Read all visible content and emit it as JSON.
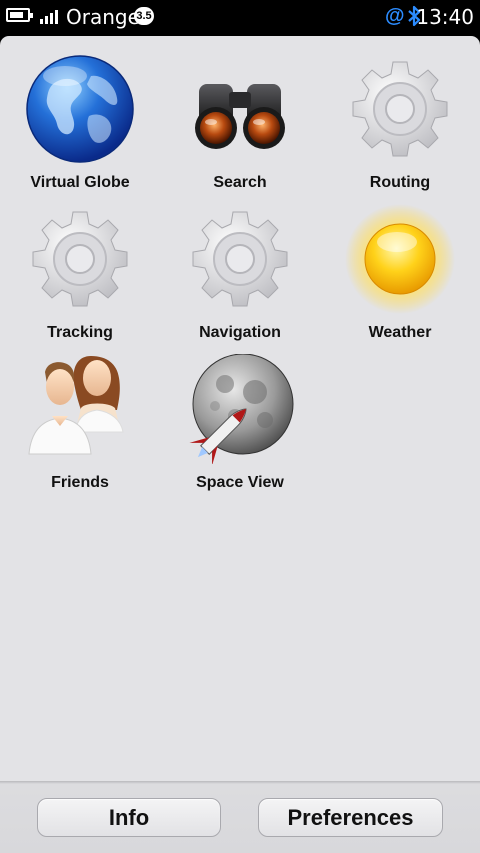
{
  "status_bar": {
    "carrier": "Orange",
    "network_badge": "3.5",
    "time": "13:40",
    "icons": [
      "battery-icon",
      "signal-strength-icon",
      "email-at-icon",
      "bluetooth-icon"
    ],
    "accent_color": "#2c8cff"
  },
  "apps": [
    {
      "label": "Virtual Globe",
      "icon": "globe-icon"
    },
    {
      "label": "Search",
      "icon": "binoculars-icon"
    },
    {
      "label": "Routing",
      "icon": "gear-icon"
    },
    {
      "label": "Tracking",
      "icon": "gear-icon"
    },
    {
      "label": "Navigation",
      "icon": "gear-icon"
    },
    {
      "label": "Weather",
      "icon": "sun-icon"
    },
    {
      "label": "Friends",
      "icon": "people-icon"
    },
    {
      "label": "Space View",
      "icon": "moon-rocket-icon"
    }
  ],
  "toolbar": {
    "info_label": "Info",
    "preferences_label": "Preferences"
  },
  "colors": {
    "panel_background": "#e3e3e6",
    "status_background": "#000000"
  }
}
